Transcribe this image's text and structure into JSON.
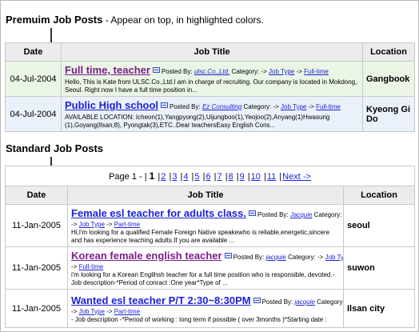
{
  "premium": {
    "heading_bold": "Premuim Job Posts",
    "heading_rest": " - Appear on top, in highlighted colors.",
    "columns": [
      "Date",
      "Job Title",
      "Location"
    ],
    "rows": [
      {
        "date": "04-Jul-2004",
        "title": "Full time, teacher",
        "posted_by_label": "Posted By:",
        "poster": "ulsc.Co.,Ltd.",
        "category_label": "Category: ->",
        "job_type": "Job Type",
        "arrow": "->",
        "type_value": "Full-time",
        "desc": "Hello, This is Kate from ULSC.Co.,Ltd.I am in charge of recruiting. Our company is located in Mokdong, Seoul. Right now I have a full time position in...",
        "location": "Gangbook"
      },
      {
        "date": "04-Jul-2004",
        "title": "Public High school",
        "posted_by_label": "Posted By:",
        "poster": "Ez Consulting",
        "category_label": "Category: ->",
        "job_type": "Job Type",
        "arrow": "->",
        "type_value": "Full-time",
        "desc": "AVAILABLE LOCATION: Icheon(1),Yangpyong(2),Uijungboo(1),Yeojoo(2),Anyang(1)Hwasung (1),Goyang(Ilsan,8), Pyongtak(3),ETC..Dear teachersEasy English Cons...",
        "location": "Kyeong Gi Do"
      }
    ]
  },
  "standard": {
    "heading": "Standard Job Posts",
    "pager": {
      "prefix": "Page 1 - |",
      "current": "1",
      "pages": [
        "2",
        "3",
        "4",
        "5",
        "6",
        "7",
        "8",
        "9",
        "10",
        "11"
      ],
      "next": "Next ->"
    },
    "columns": [
      "Date",
      "Job Title",
      "Location"
    ],
    "rows": [
      {
        "date": "11-Jan-2005",
        "title": "Female esl teacher for adults class.",
        "posted_by_label": "Posted By:",
        "poster": "Jacquie",
        "category_label": "Category:",
        "arrow1": "->",
        "job_type": "Job Type",
        "arrow2": "->",
        "type_value": "Part-time",
        "desc": "Hi,I'm looking for a qualified Female Foreign Native speakewho is reliable,energetic,sincere and has experience teaching adults.If you are available ...",
        "location": "seoul"
      },
      {
        "date": "11-Jan-2005",
        "title": "Korean female english teacher",
        "posted_by_label": "Posted By:",
        "poster": "jacquie",
        "category_label": "Category:",
        "arrow1": "->",
        "job_type": "Job Type",
        "arrow2": "->",
        "type_value": "Full-time",
        "desc": "i'm looking for a Korean Englihsh teacher for a full time position who is responsible, devoted.-Job description-*Period of  conract :One year*Type of ...",
        "location": "suwon"
      },
      {
        "date": "11-Jan-2005",
        "title": "Wanted esl teacher P/T 2:30~8:30PM",
        "posted_by_label": "Posted By:",
        "poster": "jacquie",
        "category_label": "Category:",
        "arrow1": "->",
        "job_type": "Job Type",
        "arrow2": "->",
        "type_value": "Part-time",
        "desc": "- Job description -*Period of working : long term if possible ( over 3months )*Starting date :",
        "location": "Ilsan city"
      }
    ]
  },
  "colors": {
    "premium_row_1": "#eaf5e6",
    "premium_row_2": "#eaf1fb",
    "title_purple": "#7a1f8a",
    "link_blue": "#1c22d8",
    "header_gray": "#ececec"
  },
  "icons": [
    "down-arrow-icon",
    "pin-icon"
  ]
}
